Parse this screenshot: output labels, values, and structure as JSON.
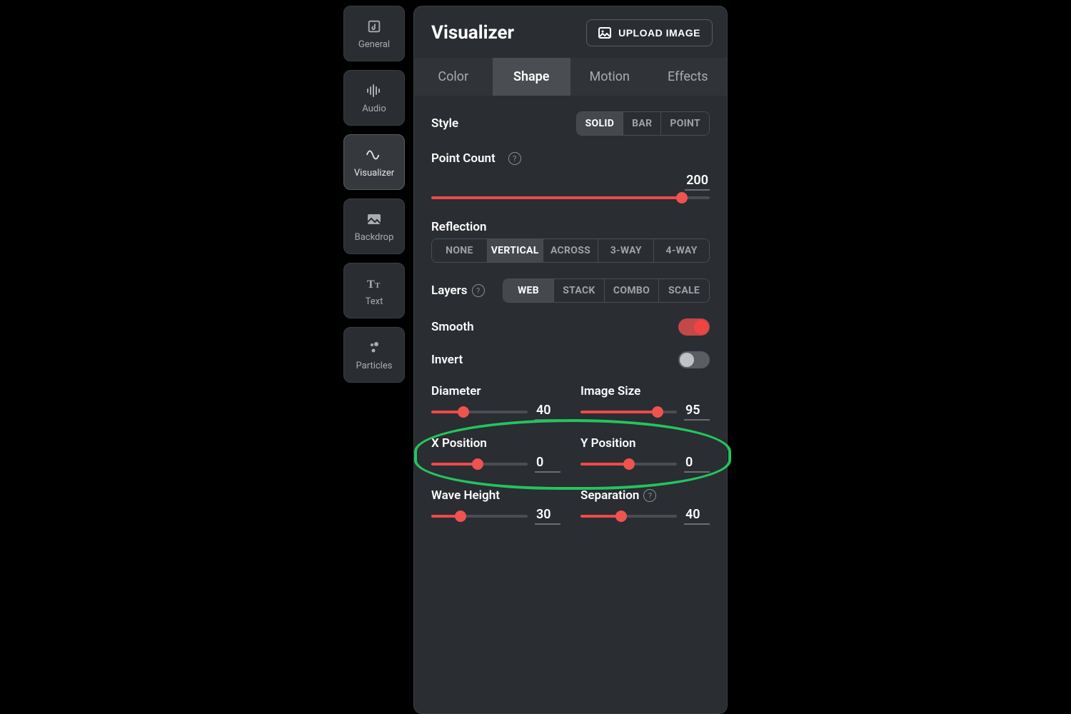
{
  "sidebar": {
    "items": [
      {
        "label": "General"
      },
      {
        "label": "Audio"
      },
      {
        "label": "Visualizer"
      },
      {
        "label": "Backdrop"
      },
      {
        "label": "Text"
      },
      {
        "label": "Particles"
      }
    ],
    "active_index": 2
  },
  "panel": {
    "title": "Visualizer",
    "upload_label": "UPLOAD IMAGE",
    "tabs": [
      "Color",
      "Shape",
      "Motion",
      "Effects"
    ],
    "active_tab": 1
  },
  "shape": {
    "style": {
      "label": "Style",
      "options": [
        "SOLID",
        "BAR",
        "POINT"
      ],
      "active": 0
    },
    "point_count": {
      "label": "Point Count",
      "value": 200,
      "min": 0,
      "max": 220,
      "percent": 90
    },
    "reflection": {
      "label": "Reflection",
      "options": [
        "NONE",
        "VERTICAL",
        "ACROSS",
        "3-WAY",
        "4-WAY"
      ],
      "active": 1
    },
    "layers": {
      "label": "Layers",
      "options": [
        "WEB",
        "STACK",
        "COMBO",
        "SCALE"
      ],
      "active": 0
    },
    "smooth": {
      "label": "Smooth",
      "value": true
    },
    "invert": {
      "label": "Invert",
      "value": false
    },
    "diameter": {
      "label": "Diameter",
      "value": 40,
      "percent": 33
    },
    "image_size": {
      "label": "Image Size",
      "value": 95,
      "percent": 80
    },
    "x_position": {
      "label": "X Position",
      "value": 0,
      "percent": 48
    },
    "y_position": {
      "label": "Y Position",
      "value": 0,
      "percent": 50
    },
    "wave_height": {
      "label": "Wave Height",
      "value": 30,
      "percent": 30
    },
    "separation": {
      "label": "Separation",
      "value": 40,
      "percent": 42
    }
  },
  "help_glyph": "?"
}
